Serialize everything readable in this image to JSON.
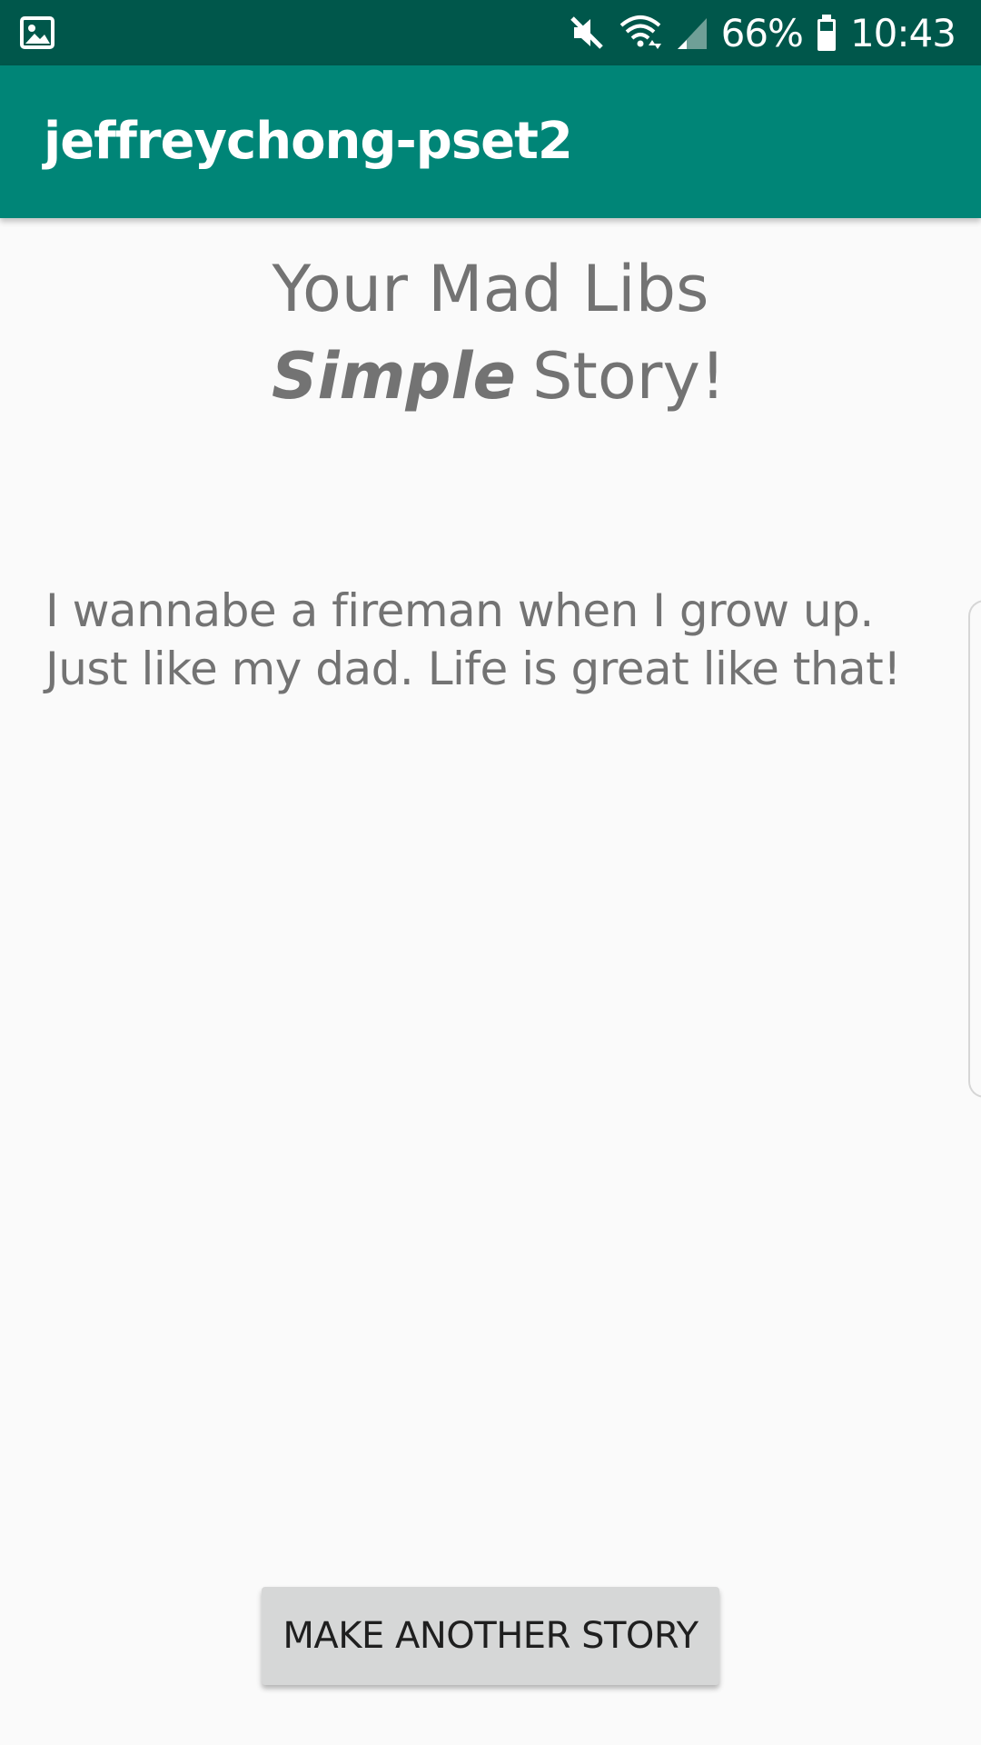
{
  "status_bar": {
    "battery": "66%",
    "time": "10:43",
    "icons": [
      "gallery-notification-icon",
      "mute-icon",
      "wifi-icon",
      "signal-icon",
      "battery-icon"
    ]
  },
  "app_bar": {
    "title": "jeffreychong-pset2",
    "color": "#008577"
  },
  "heading": {
    "line1": "Your Mad Libs",
    "emphasis": "Simple",
    "line2_rest": "Story!"
  },
  "story": {
    "text": "I wannabe a fireman when I grow up. Just like my dad. Life is great like that!"
  },
  "actions": {
    "make_another_label": "MAKE ANOTHER STORY"
  }
}
